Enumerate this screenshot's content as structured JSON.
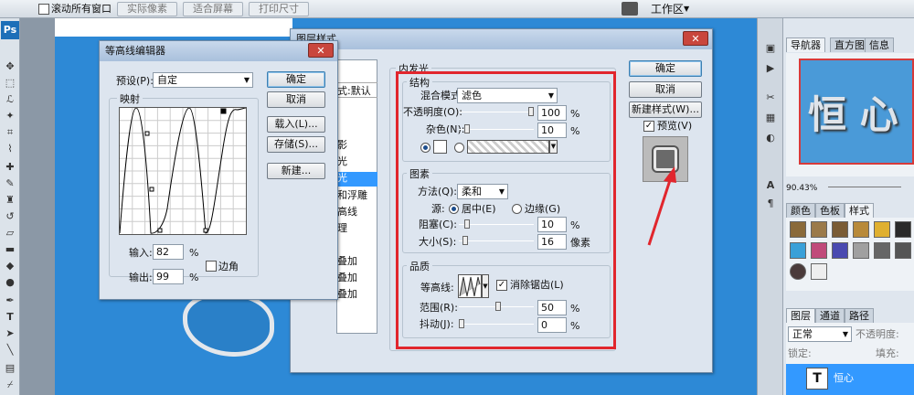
{
  "option_bar": {
    "scroll_all": "滚动所有窗口",
    "actual_pixels": "实际像素",
    "fit_screen": "适合屏幕",
    "print_size": "打印尺寸",
    "workspace": "工作区"
  },
  "toolbox": {
    "logo": "Ps"
  },
  "contour_editor": {
    "title": "等高线编辑器",
    "preset_label": "预设(P):",
    "preset_value": "自定",
    "mapping_label": "映射",
    "ok": "确定",
    "cancel": "取消",
    "load": "载入(L)...",
    "save": "存储(S)...",
    "new": "新建...",
    "input_label": "输入:",
    "input_value": "82",
    "output_label": "输出:",
    "output_value": "99",
    "percent": "%",
    "corner_label": "边角"
  },
  "layer_style": {
    "title": "图层样式",
    "left_items": [
      "",
      "式:默认",
      "",
      "影",
      "光",
      "光",
      "和浮雕",
      "高线",
      "理",
      "",
      "叠加",
      "叠加",
      "叠加",
      ""
    ],
    "inner_glow_title": "内发光",
    "structure_title": "结构",
    "blend_mode_label": "混合模式:",
    "blend_mode_value": "滤色",
    "opacity_label": "不透明度(O):",
    "opacity_value": "100",
    "noise_label": "杂色(N):",
    "noise_value": "10",
    "percent": "%",
    "elements_title": "图素",
    "technique_label": "方法(Q):",
    "technique_value": "柔和",
    "source_label": "源:",
    "source_center": "居中(E)",
    "source_edge": "边缘(G)",
    "choke_label": "阻塞(C):",
    "choke_value": "10",
    "size_label": "大小(S):",
    "size_value": "16",
    "px": "像素",
    "quality_title": "品质",
    "contour_label": "等高线:",
    "antialias_label": "消除锯齿(L)",
    "range_label": "范围(R):",
    "range_value": "50",
    "jitter_label": "抖动(J):",
    "jitter_value": "0",
    "ok": "确定",
    "cancel": "取消",
    "new_style": "新建样式(W)...",
    "preview": "预览(V)"
  },
  "right_panel": {
    "nav_tabs": [
      "导航器",
      "直方图",
      "信息"
    ],
    "zoom": "90.43%",
    "preview_text": "恒 心",
    "color_tabs": [
      "颜色",
      "色板",
      "样式"
    ],
    "layer_tabs": [
      "图层",
      "通道",
      "路径"
    ],
    "blend_mode": "正常",
    "opacity_label": "不透明度:",
    "lock_label": "锁定:",
    "fill_label": "填充:",
    "layer_name": "恒心",
    "layer_icon": "T",
    "colors": {
      "swatches": [
        "#8a6a3a",
        "#9b7a4a",
        "#7a5c35",
        "#b88a3a",
        "#6a5a4a",
        "#444444",
        "#e0b030",
        "#2a2a2a",
        "#3aa0d8",
        "#c04a7a",
        "#4a4ab0",
        "#a0a0a0",
        "#888888",
        "#666666",
        "#555555",
        "#777777",
        "#4a3a3a",
        "#eeeeee"
      ]
    }
  },
  "colors": {
    "canvas": "#2d89d6",
    "highlight_red": "#e1262d"
  }
}
